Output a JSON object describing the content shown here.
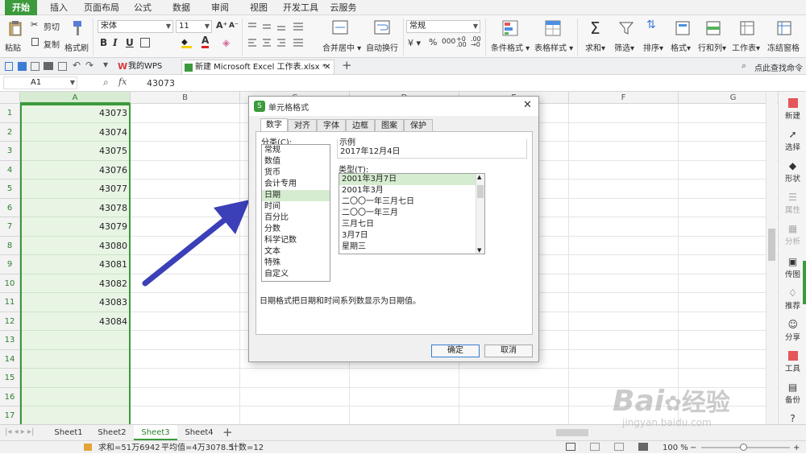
{
  "menu": {
    "tabs": [
      "开始",
      "插入",
      "页面布局",
      "公式",
      "数据",
      "审阅",
      "视图",
      "开发工具",
      "云服务"
    ]
  },
  "ribbon": {
    "paste": "粘贴",
    "cut": "剪切",
    "copy": "复制",
    "format_painter": "格式刷",
    "font_name": "宋体",
    "font_size": "11",
    "bold": "B",
    "italic": "I",
    "underline": "U",
    "font_color_label": "A",
    "merge_center": "合并居中",
    "wrap_text": "自动换行",
    "number_format": "常规",
    "percent": "%",
    "conditional_format": "条件格式",
    "table_style": "表格样式",
    "sum": "求和",
    "filter": "筛选",
    "sort": "排序",
    "format": "格式",
    "row_col": "行和列",
    "worksheet": "工作表",
    "freeze": "冻结窗格"
  },
  "doc_tabs": {
    "wps": "我的WPS",
    "file": "新建 Microsoft Excel 工作表.xlsx *",
    "find_cmd": "点此查找命令"
  },
  "formula_bar": {
    "name_box": "A1",
    "fx": "fx",
    "value": "43073"
  },
  "grid": {
    "columns": [
      "A",
      "B",
      "C",
      "D",
      "E",
      "F",
      "G"
    ],
    "rows": [
      "1",
      "2",
      "3",
      "4",
      "5",
      "6",
      "7",
      "8",
      "9",
      "10",
      "11",
      "12",
      "13",
      "14",
      "15",
      "16",
      "17"
    ],
    "col_a_values": [
      "43073",
      "43074",
      "43075",
      "43076",
      "43077",
      "43078",
      "43079",
      "43080",
      "43081",
      "43082",
      "43083",
      "43084",
      "",
      "",
      "",
      "",
      ""
    ]
  },
  "side_panel": {
    "items": [
      "新建",
      "选择",
      "形状",
      "属性",
      "分析",
      "传图",
      "推荐",
      "分享",
      "工具",
      "备份",
      "帮助"
    ],
    "enabled": [
      true,
      true,
      true,
      false,
      false,
      true,
      true,
      true,
      true,
      true,
      true
    ]
  },
  "sheets": {
    "tabs": [
      "Sheet1",
      "Sheet2",
      "Sheet3",
      "Sheet4"
    ],
    "active": "Sheet3"
  },
  "status": {
    "sum": "求和=51万6942",
    "avg": "平均值=4万3078.5",
    "count": "计数=12",
    "zoom": "100 %"
  },
  "dialog": {
    "title": "单元格格式",
    "tabs": [
      "数字",
      "对齐",
      "字体",
      "边框",
      "图案",
      "保护"
    ],
    "category_label": "分类(C):",
    "categories": [
      "常规",
      "数值",
      "货币",
      "会计专用",
      "日期",
      "时间",
      "百分比",
      "分数",
      "科学记数",
      "文本",
      "特殊",
      "自定义"
    ],
    "selected_category": "日期",
    "sample_label": "示例",
    "sample_value": "2017年12月4日",
    "type_label": "类型(T):",
    "types": [
      "2001年3月7日",
      "2001年3月",
      "二〇〇一年三月七日",
      "二〇〇一年三月",
      "三月七日",
      "3月7日",
      "星期三"
    ],
    "selected_type": "2001年3月7日",
    "description": "日期格式把日期和时间系列数显示为日期值。",
    "ok": "确定",
    "cancel": "取消"
  },
  "watermark": {
    "brand": "Bai",
    "brand2": "经验",
    "url": "jingyan.baidu.com"
  },
  "colors": {
    "accent": "#3c9a3c",
    "arrow": "#3b3fb8",
    "selection_fill": "#e8f4e4"
  }
}
